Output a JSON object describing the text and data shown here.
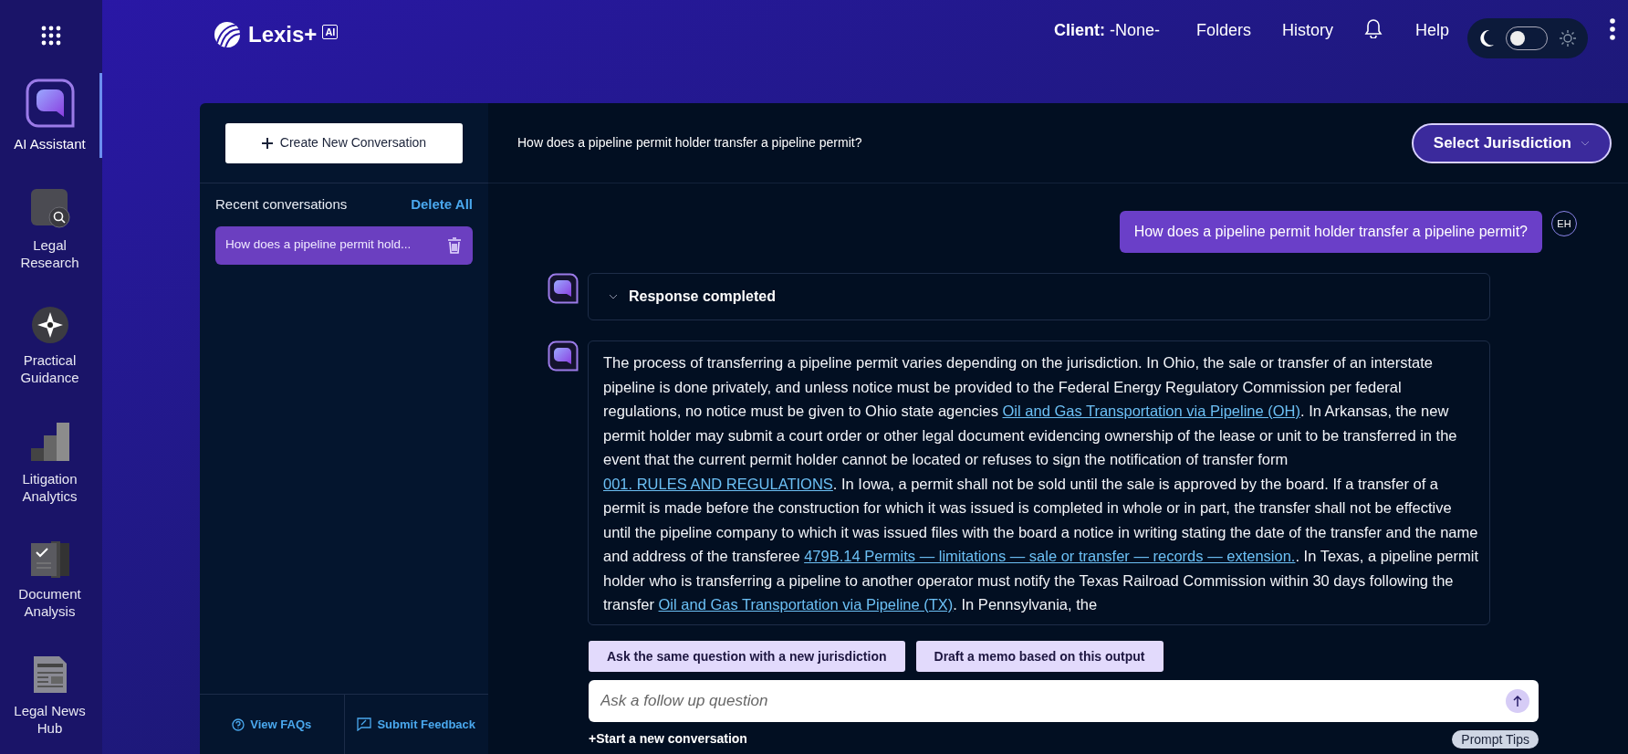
{
  "nav_rail": {
    "items": [
      {
        "kind": "assistant",
        "label": "AI Assistant",
        "selected": true
      },
      {
        "kind": "research",
        "label": "Legal Research",
        "selected": false
      },
      {
        "kind": "guidance",
        "label": "Practical Guidance",
        "selected": false
      },
      {
        "kind": "analytics",
        "label": "Litigation Analytics",
        "selected": false
      },
      {
        "kind": "document",
        "label": "Document Analysis",
        "selected": false
      },
      {
        "kind": "news",
        "label": "Legal News Hub",
        "selected": false
      }
    ]
  },
  "header": {
    "logo": {
      "text": "Lexis+",
      "badge": "AI"
    },
    "client": "**Client:** -None-",
    "nav": [
      {
        "kind": "link",
        "label": "Folders"
      },
      {
        "kind": "link",
        "label": "History"
      },
      {
        "kind": "bell"
      },
      {
        "kind": "link",
        "label": "Help"
      }
    ],
    "theme_toggle": {
      "on": false
    }
  },
  "conversations_panel": {
    "create_button": "Create New Conversation",
    "heading": "Recent conversations",
    "delete_all": "Delete All",
    "items": [
      {
        "title": "How does a pipeline permit hold...",
        "selected": true
      }
    ],
    "footer": [
      {
        "kind": "faq",
        "label": "View FAQs"
      },
      {
        "kind": "feedback",
        "label": "Submit Feedback"
      }
    ]
  },
  "chat": {
    "title": "How does a pipeline permit holder transfer a pipeline permit?",
    "jurisdiction_button": "Select Jurisdiction",
    "user_message": {
      "text": "How does a pipeline permit holder transfer a pipeline permit?",
      "avatar": "EH"
    },
    "status": {
      "label": "Response completed",
      "expanded": false
    },
    "answer": [
      {
        "kind": "text",
        "text": "The process of transferring a pipeline permit varies depending on the jurisdiction. In Ohio, the sale or transfer of an interstate pipeline is done privately, and unless notice must be provided to the Federal Energy Regulatory Commission per federal regulations, no notice must be given to Ohio state agencies "
      },
      {
        "kind": "link",
        "text": "Oil and Gas Transportation via Pipeline (OH)"
      },
      {
        "kind": "text",
        "text": ". In Arkansas, the new permit holder may submit a court order or other legal document evidencing ownership of the lease or unit to be transferred in the event that the current permit holder cannot be located or refuses to sign the notification of transfer form "
      },
      {
        "kind": "link",
        "text": "001. RULES AND REGULATIONS"
      },
      {
        "kind": "text",
        "text": ". In Iowa, a permit shall not be sold until the sale is approved by the board. If a transfer of a permit is made before the construction for which it was issued is completed in whole or in part, the transfer shall not be effective until the pipeline company to which it was issued files with the board a notice in writing stating the date of the transfer and the name and address of the transferee "
      },
      {
        "kind": "link",
        "text": "479B.14 Permits — limitations — sale or transfer — records — extension."
      },
      {
        "kind": "text",
        "text": ". In Texas, a pipeline permit holder who is transferring a pipeline to another operator must notify the Texas Railroad Commission within 30 days following the transfer "
      },
      {
        "kind": "link",
        "text": "Oil and Gas Transportation via Pipeline (TX)"
      },
      {
        "kind": "text",
        "text": ". In Pennsylvania, the"
      }
    ],
    "suggestions": [
      "Ask the same question with a new jurisdiction",
      "Draft a memo based on this output"
    ],
    "input": {
      "placeholder": "Ask a follow up question"
    },
    "new_conversation": "+Start a new conversation",
    "prompt_tips": "Prompt Tips"
  }
}
